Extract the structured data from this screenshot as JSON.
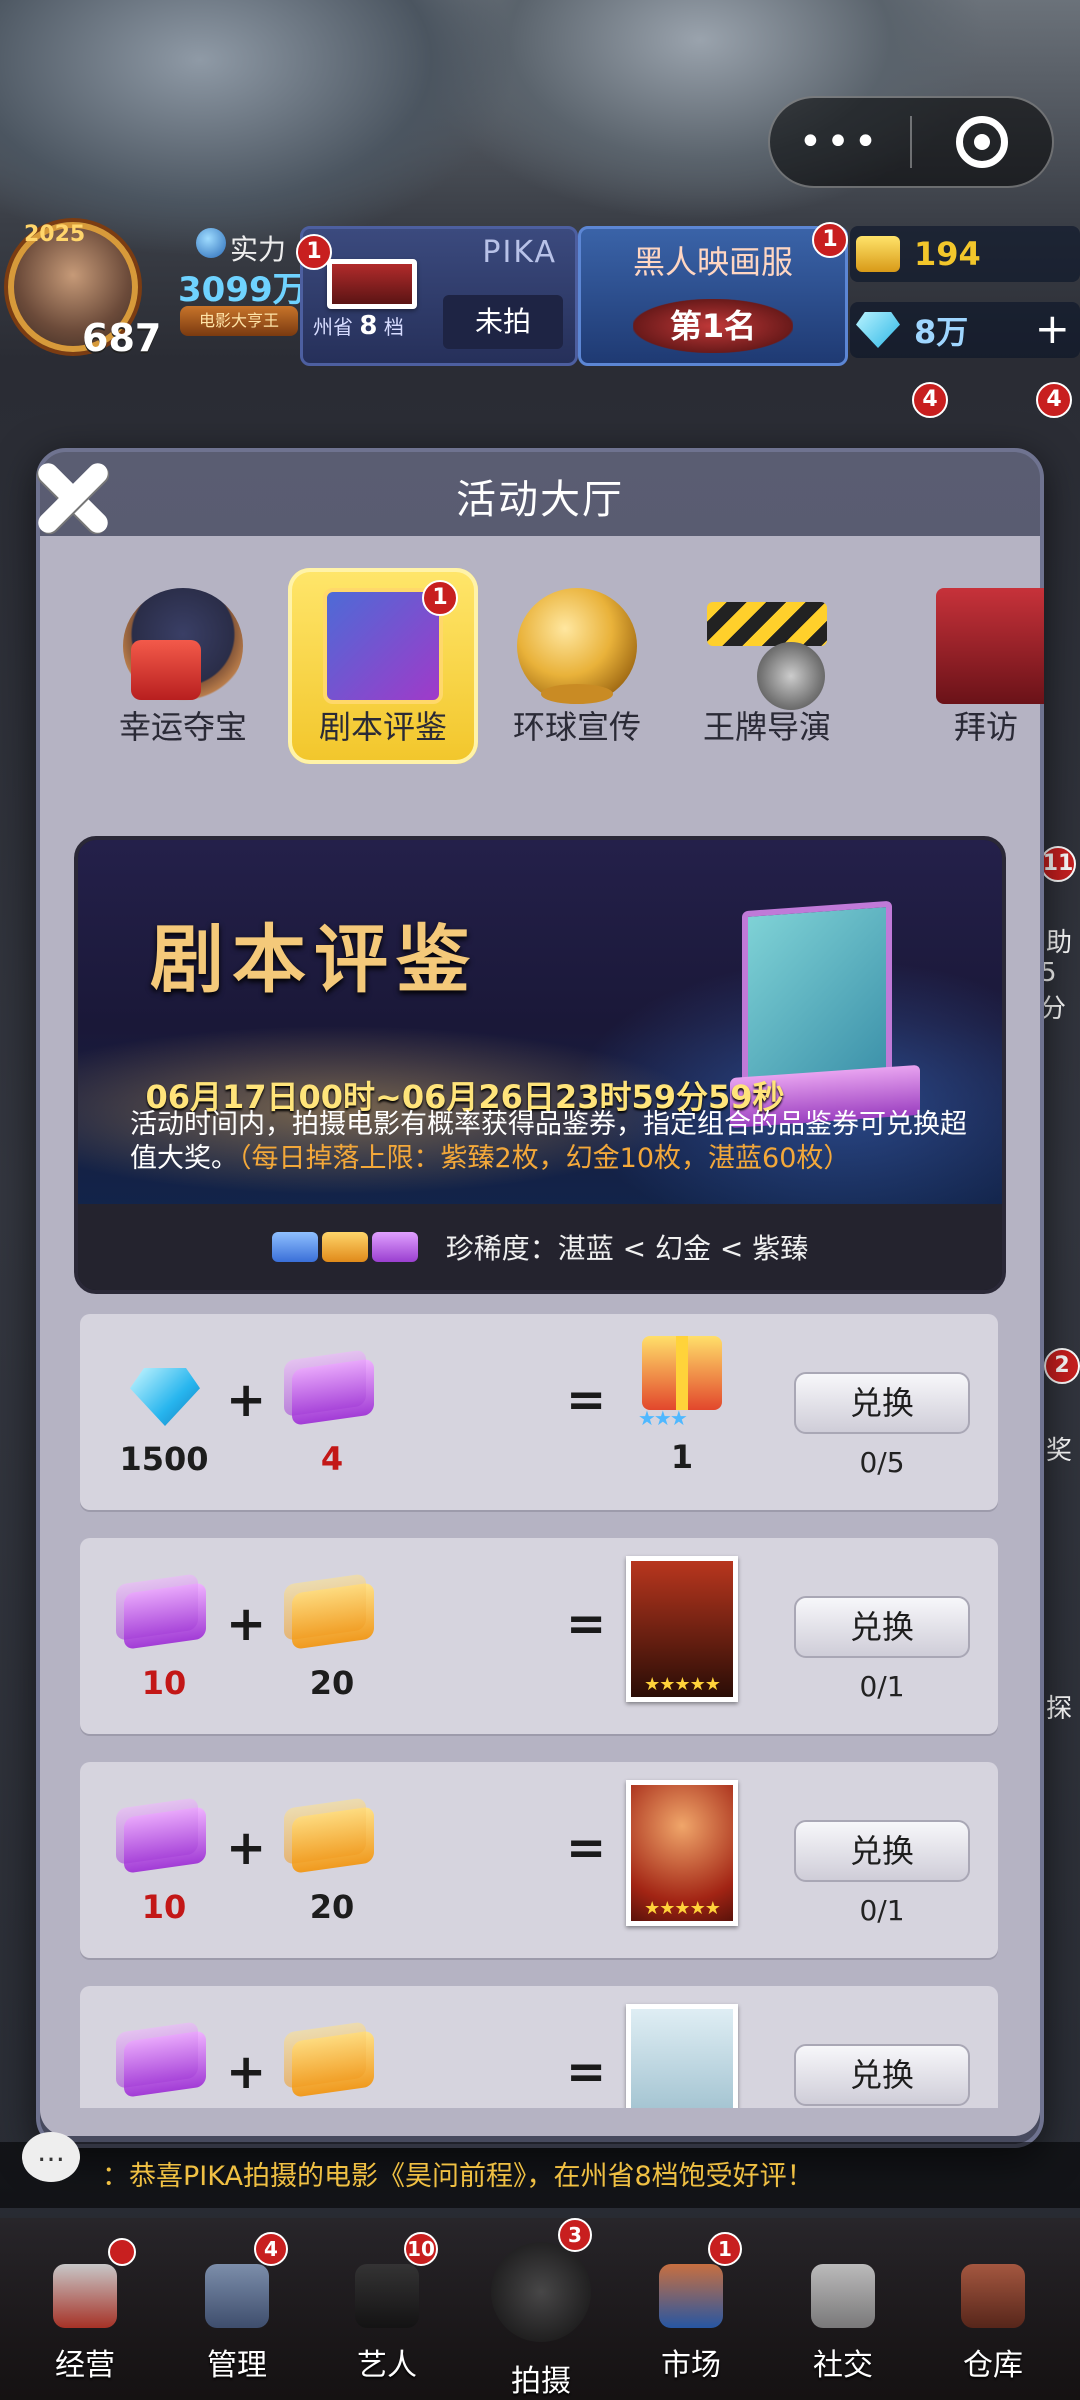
{
  "hud": {
    "capsule_dots": "•••",
    "level": "687",
    "avatar_tag": "2025",
    "power_label": "实力",
    "power_value": "3099万",
    "power_badge": "电影大亨王",
    "pika_badge": "1",
    "pika_name": "PIKA",
    "pika_state": "未拍",
    "pika_province_label": "州省",
    "pika_province_num": "8",
    "pika_province_unit": "档",
    "movie_badge": "1",
    "movie_title": "黑人映画服",
    "movie_rank": "第1名",
    "tickets": "194",
    "gems": "8万",
    "side_badge_a": "4",
    "side_badge_b": "4"
  },
  "modal": {
    "title": "活动大厅",
    "tabs": [
      {
        "label": "幸运夺宝",
        "icon": "lucky-treasure-icon"
      },
      {
        "label": "剧本评鉴",
        "icon": "script-review-icon",
        "badge": "1",
        "active": true
      },
      {
        "label": "环球宣传",
        "icon": "globe-trophy-icon"
      },
      {
        "label": "王牌导演",
        "icon": "clapperboard-icon"
      },
      {
        "label": "拜访",
        "icon": "visit-icon"
      }
    ]
  },
  "banner": {
    "title": "剧本评鉴",
    "date": "06月17日00时~06月26日23时59分59秒",
    "desc": "活动时间内，拍摄电影有概率获得品鉴券，指定组合的品鉴券可兑换超值大奖。",
    "desc_highlight": "（每日掉落上限：紫臻2枚，幻金10枚，湛蓝60枚）",
    "rarity": "珍稀度：湛蓝 < 幻金 < 紫臻"
  },
  "rows": [
    {
      "a": "1500",
      "b": "4",
      "reward": "1",
      "button": "兑换",
      "limit": "0/5"
    },
    {
      "a": "10",
      "b": "20",
      "button": "兑换",
      "limit": "0/1"
    },
    {
      "a": "10",
      "b": "20",
      "button": "兑换",
      "limit": "0/1"
    },
    {
      "button": "兑换"
    }
  ],
  "ops": {
    "plus": "+",
    "eq": "="
  },
  "side": {
    "badge_11": "11",
    "help": "助",
    "help2": "5分",
    "badge_2": "2",
    "prize": "奖",
    "shoot": "探"
  },
  "ticker": {
    "icon": "…",
    "message": "：恭喜PIKA拍摄的电影《昊问前程》，在州省8档饱受好评！"
  },
  "nav": [
    {
      "label": "经营",
      "icon": "popcorn-icon"
    },
    {
      "label": "管理",
      "icon": "manage-icon",
      "badge": "4"
    },
    {
      "label": "艺人",
      "icon": "artist-icon",
      "badge": "10"
    },
    {
      "label": "拍摄",
      "icon": "film-camera-icon",
      "badge": "3"
    },
    {
      "label": "市场",
      "icon": "market-icon",
      "badge": "1"
    },
    {
      "label": "社交",
      "icon": "social-icon"
    },
    {
      "label": "仓库",
      "icon": "warehouse-icon"
    }
  ],
  "colors": {
    "accent_yellow": "#f2c62b",
    "highlight_orange": "#f3a83a",
    "date_gold": "#ffe47a",
    "badge_red": "#c81f1f"
  }
}
